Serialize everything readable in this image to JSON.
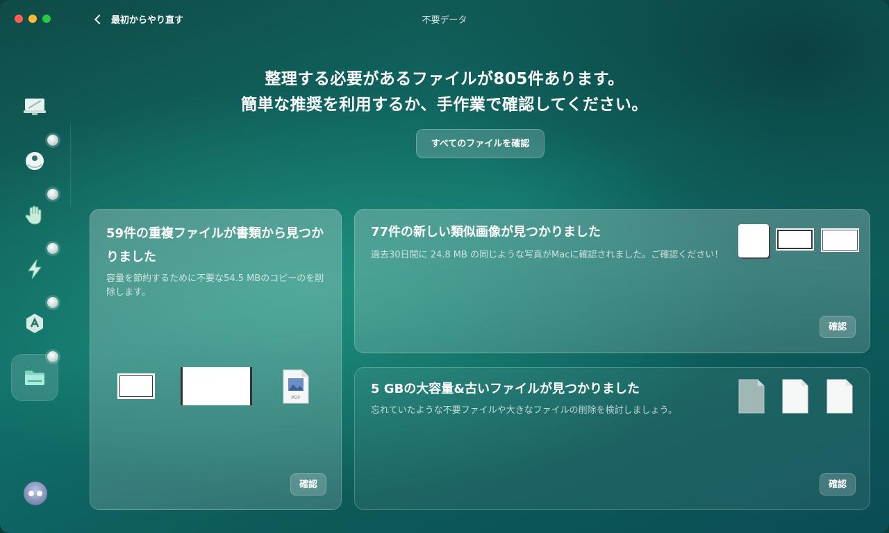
{
  "window": {
    "title": "不要データ"
  },
  "nav": {
    "back_label": "最初からやり直す"
  },
  "sidebar": {
    "items": [
      {
        "name": "smart-scan",
        "icon": "display-icon",
        "has_badge": false,
        "active": false
      },
      {
        "name": "cleanup",
        "icon": "disc-icon",
        "has_badge": true,
        "active": false
      },
      {
        "name": "protection",
        "icon": "hand-icon",
        "has_badge": true,
        "active": false
      },
      {
        "name": "performance",
        "icon": "lightning-icon",
        "has_badge": true,
        "active": false
      },
      {
        "name": "applications",
        "icon": "app-tools-icon",
        "has_badge": true,
        "active": false
      },
      {
        "name": "my-clutter",
        "icon": "folder-icon",
        "has_badge": true,
        "active": true
      }
    ],
    "assistant_icon": "assistant-icon"
  },
  "headline": {
    "line1": "整理する必要があるファイルが805件あります。",
    "line2": "簡単な推奨を利用するか、手作業で確認してください。"
  },
  "review_all_label": "すべてのファイルを確認",
  "cards": {
    "duplicates": {
      "title": "59件の重複ファイルが書類から見つかりました",
      "description": "容量を節約するために不要な54.5 MBのコピーのを削除します。",
      "button": "確認",
      "pdf_label": "PDF"
    },
    "similar": {
      "title": "77件の新しい類似画像が見つかりました",
      "description": "過去30日間に 24.8 MB の同じような写真がMacに確認されました。ご確認ください！",
      "button": "確認"
    },
    "large_old": {
      "title": "5 GBの大容量&古いファイルが見つかりました",
      "description": "忘れていたような不要ファイルや大きなファイルの削除を検討しましょう。",
      "button": "確認"
    }
  },
  "colors": {
    "accent": "#1a7a70",
    "traffic_red": "#ff5f57",
    "traffic_yellow": "#febc2e",
    "traffic_green": "#28c840"
  }
}
